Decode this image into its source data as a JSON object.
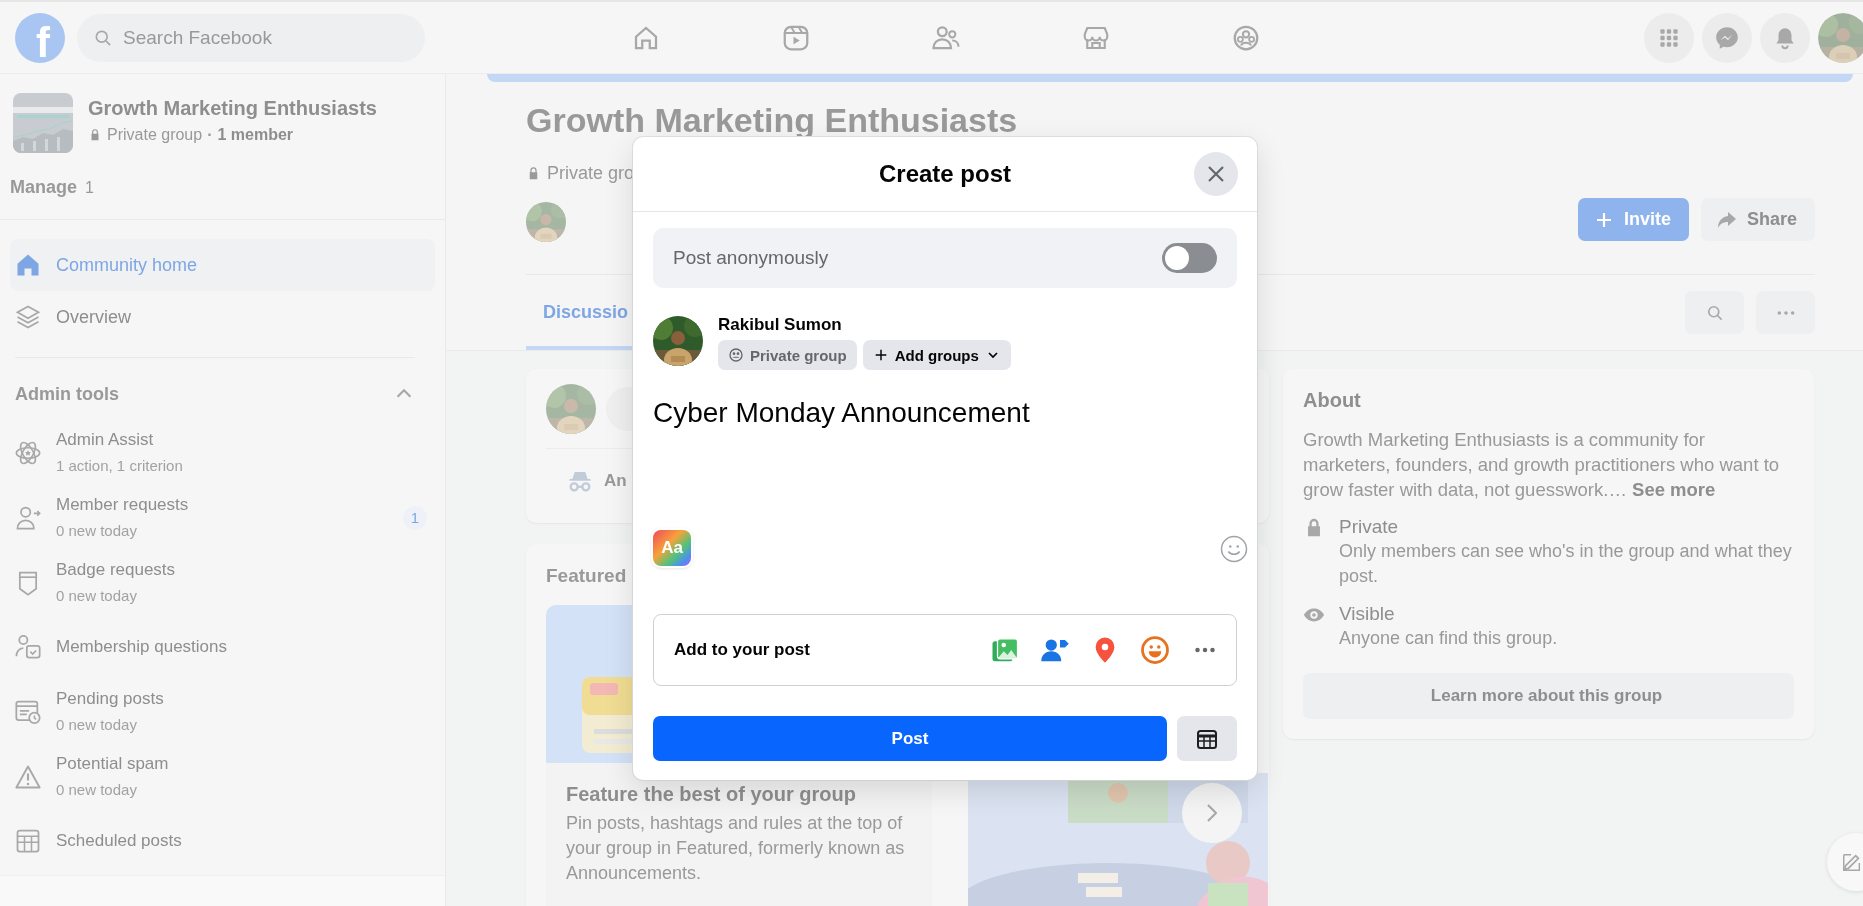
{
  "topbar": {
    "logo": "f",
    "search": {
      "placeholder": "Search Facebook"
    }
  },
  "sidebar": {
    "group": {
      "name": "Growth Marketing Enthusiasts",
      "privacy": "Private group",
      "separator": "·",
      "members": "1 member"
    },
    "manage": {
      "label": "Manage",
      "count": "1"
    },
    "nav": [
      {
        "label": "Community home",
        "selected": true
      },
      {
        "label": "Overview",
        "selected": false
      }
    ],
    "admin_tools": {
      "title": "Admin tools",
      "expanded": true,
      "items": [
        {
          "label": "Admin Assist",
          "detail": "1 action, 1 criterion"
        },
        {
          "label": "Member requests",
          "detail": "0 new today",
          "badge": "1"
        },
        {
          "label": "Badge requests",
          "detail": "0 new today"
        },
        {
          "label": "Membership questions"
        },
        {
          "label": "Pending posts",
          "detail": "0 new today"
        },
        {
          "label": "Potential spam",
          "detail": "0 new today"
        },
        {
          "label": "Scheduled posts"
        }
      ]
    }
  },
  "header": {
    "title": "Growth Marketing Enthusiasts",
    "privacy": "Private gro",
    "buttons": [
      {
        "label": "Invite",
        "kind": "primary"
      },
      {
        "label": "Share",
        "kind": "secondary"
      }
    ]
  },
  "tabs": [
    {
      "label": "Discussio",
      "selected": true
    }
  ],
  "composer": {
    "anonymous_label": "An"
  },
  "featured": {
    "title": "Featured",
    "cards": [
      {
        "title": "Feature the best of your group",
        "text": "Pin posts, hashtags and rules at the top of your group in Featured, formerly known as Announcements."
      }
    ]
  },
  "about": {
    "title": "About",
    "description": "Growth Marketing Enthusiasts is a community for marketers, founders, and growth practitioners who want to grow faster with data, not guesswork.…",
    "link": "See more",
    "items": [
      {
        "title": "Private",
        "text": "Only members can see who's in the group and what they post."
      },
      {
        "title": "Visible",
        "text": "Anyone can find this group."
      }
    ],
    "button": "Learn more about this group"
  },
  "modal": {
    "title": "Create post",
    "anonymous": {
      "label": "Post anonymously",
      "on": false
    },
    "author": "Rakibul Sumon",
    "audience": "Private group",
    "add_groups": "Add groups",
    "text": "Cyber Monday Announcement",
    "format_label": "Aa",
    "add_to_post": "Add to your post",
    "post_button": "Post"
  }
}
